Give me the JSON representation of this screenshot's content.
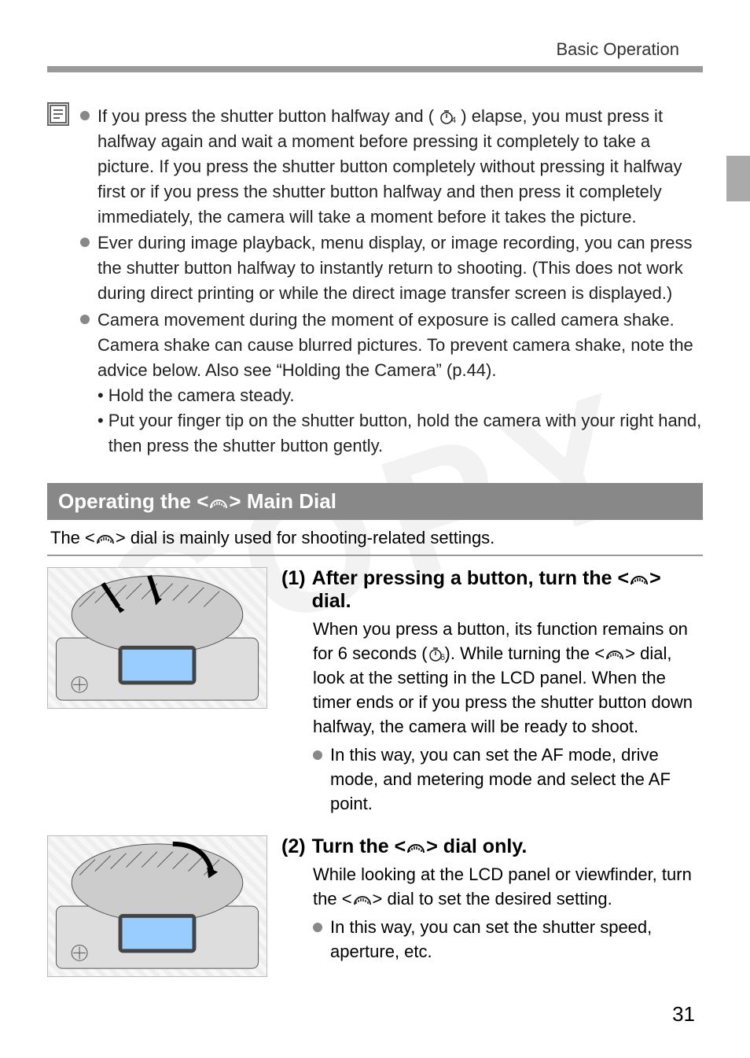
{
  "header": {
    "section": "Basic Operation"
  },
  "watermark": "COPY",
  "timer4_label": "4",
  "timer6_label": "6",
  "notes": {
    "items": [
      {
        "pre": "If you press the shutter button halfway and (",
        "post": ") elapse, you must press it halfway again and wait a moment before pressing it completely to take a picture. If you press the shutter button completely without pressing it halfway first or if you press the shutter button halfway and then press it completely immediately, the camera will take a moment before it takes the picture."
      },
      {
        "text": "Ever during image playback, menu display, or image recording, you can press the shutter button halfway to instantly return to shooting. (This does not work during direct printing or while the direct image transfer screen is displayed.)"
      },
      {
        "text": "Camera movement during the moment of exposure is called camera shake. Camera shake can cause blurred pictures. To prevent camera shake, note the advice below. Also see “Holding the Camera” (p.44).",
        "sub": [
          "Hold the camera steady.",
          "Put your finger tip on the shutter button, hold the camera with your right hand, then press the shutter button gently."
        ]
      }
    ]
  },
  "main_dial_section": {
    "title_pre": "Operating the <",
    "title_post": "> Main Dial",
    "intro_pre": "The <",
    "intro_post": "> dial is mainly used for shooting-related settings."
  },
  "steps": [
    {
      "num": "(1)",
      "title_pre": "After pressing a button, turn the <",
      "title_post": "> dial.",
      "body_pre": "When you press a button, its function remains on for 6 seconds (",
      "body_mid": "). While turning the <",
      "body_post": "> dial, look at the setting in the LCD panel. When the timer ends or if you press the shutter button down halfway, the camera will be ready to shoot.",
      "bullet": "In this way, you can set the AF mode, drive mode, and metering mode and select the AF point."
    },
    {
      "num": "(2)",
      "title_pre": "Turn the <",
      "title_post": "> dial only.",
      "body_pre": "While looking at the LCD panel or viewfinder, turn the <",
      "body_post": "> dial to set the desired setting.",
      "bullet": "In this way, you can set the shutter speed, aperture, etc."
    }
  ],
  "page_number": "31"
}
